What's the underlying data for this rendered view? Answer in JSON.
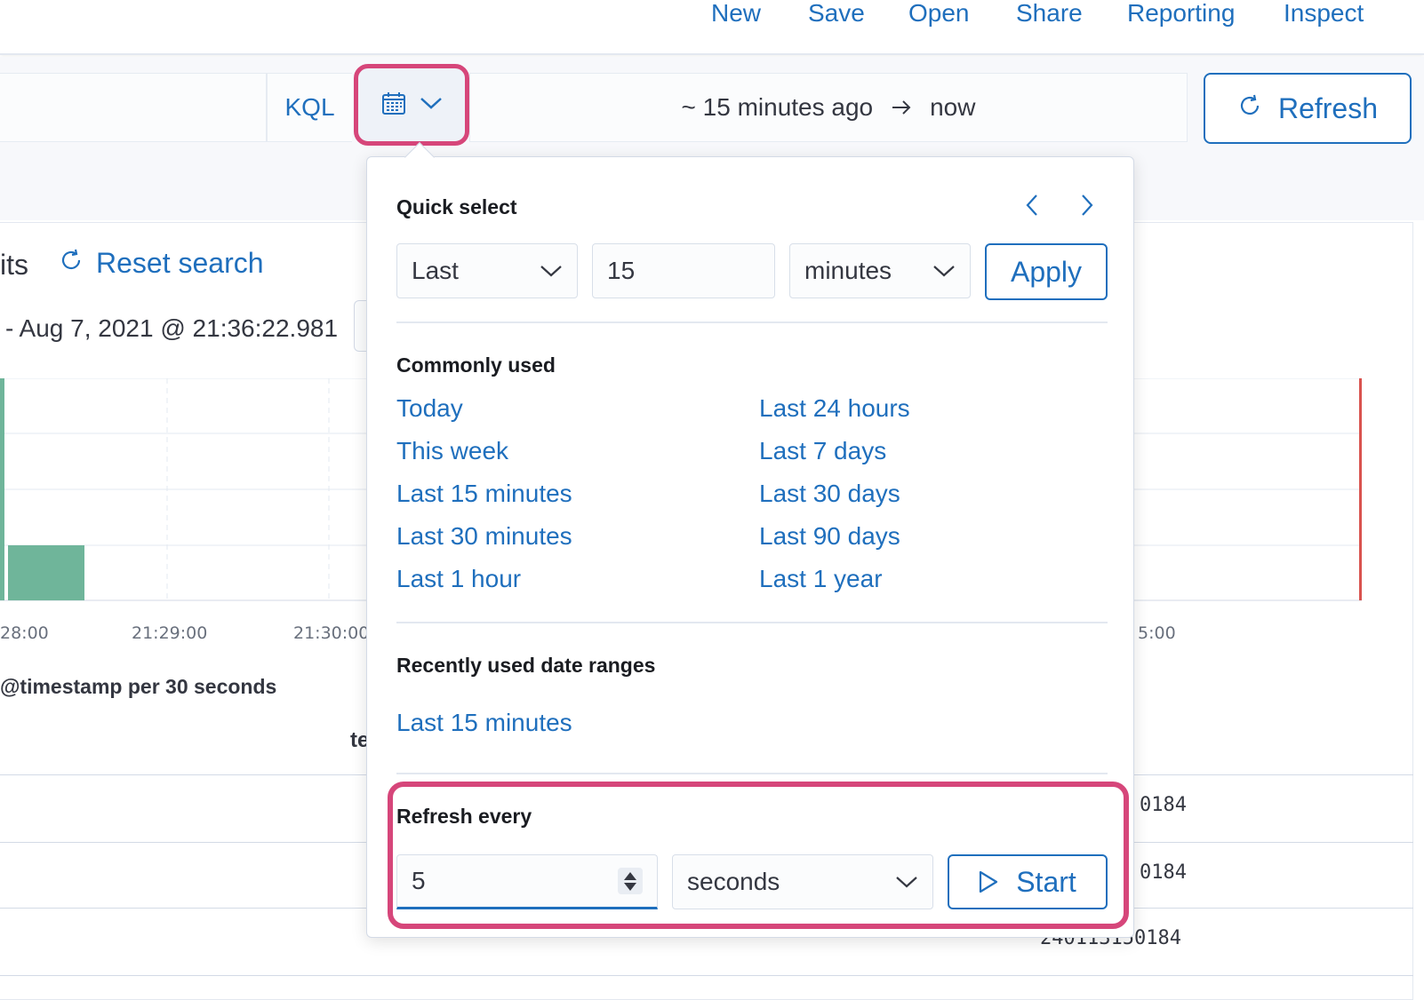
{
  "topnav": {
    "items": [
      {
        "label": "New"
      },
      {
        "label": "Save"
      },
      {
        "label": "Open"
      },
      {
        "label": "Share"
      },
      {
        "label": "Reporting"
      },
      {
        "label": "Inspect"
      }
    ]
  },
  "querybar": {
    "language_label": "KQL",
    "date_start": "~ 15 minutes ago",
    "date_end": "now",
    "refresh_label": "Refresh"
  },
  "main": {
    "hits_tail": "its",
    "reset_search_label": "Reset search",
    "date_caption": "- Aug 7, 2021 @ 21:36:22.981",
    "chart_ticks": [
      "28:00",
      "21:29:00",
      "21:30:00",
      "5:00"
    ],
    "chart_xlabel": "@timestamp per 30 seconds",
    "column_header_stub": "te",
    "row_values": [
      "0184",
      "0184",
      "240113150184"
    ],
    "colors": {
      "bar": "#6fb59a",
      "marker": "#d9534f"
    }
  },
  "popover": {
    "quick_select": {
      "title": "Quick select",
      "tense": "Last",
      "value": "15",
      "unit": "minutes",
      "apply_label": "Apply"
    },
    "commonly_used": {
      "title": "Commonly used",
      "left": [
        "Today",
        "This week",
        "Last 15 minutes",
        "Last 30 minutes",
        "Last 1 hour"
      ],
      "right": [
        "Last 24 hours",
        "Last 7 days",
        "Last 30 days",
        "Last 90 days",
        "Last 1 year"
      ]
    },
    "recent": {
      "title": "Recently used date ranges",
      "items": [
        "Last 15 minutes"
      ]
    },
    "refresh": {
      "title": "Refresh every",
      "value": "5",
      "unit": "seconds",
      "start_label": "Start"
    }
  },
  "colors": {
    "link": "#1f6fbd",
    "highlight": "#d6467a"
  }
}
